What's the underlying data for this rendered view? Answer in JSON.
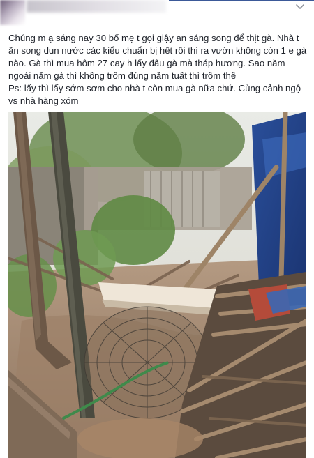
{
  "post": {
    "lines": [
      "Chúng m ạ sáng nay 30 bố mẹ t gọi giậy an sáng song để thịt gà. Nhà t ăn song dun nước các kiểu chuẩn bị hết rồi thì ra vườn không còn 1 e gà nào. Gà thì mua hôm 27 cay h lấy đâu gà mà tháp hương. Sao năm ngoái năm gà thì không trôm đúng năm tuất thì trôm thế",
      "Ps: lấy thì lấy sớm sơm cho nhà t còn mua gà nữa chứ. Cùng cảnh ngộ vs nhà hàng xóm"
    ]
  },
  "icons": {
    "options": "chevron-down-icon"
  },
  "colors": {
    "text": "#1d2129",
    "accent": "#3b5998",
    "muted": "#90949c"
  }
}
